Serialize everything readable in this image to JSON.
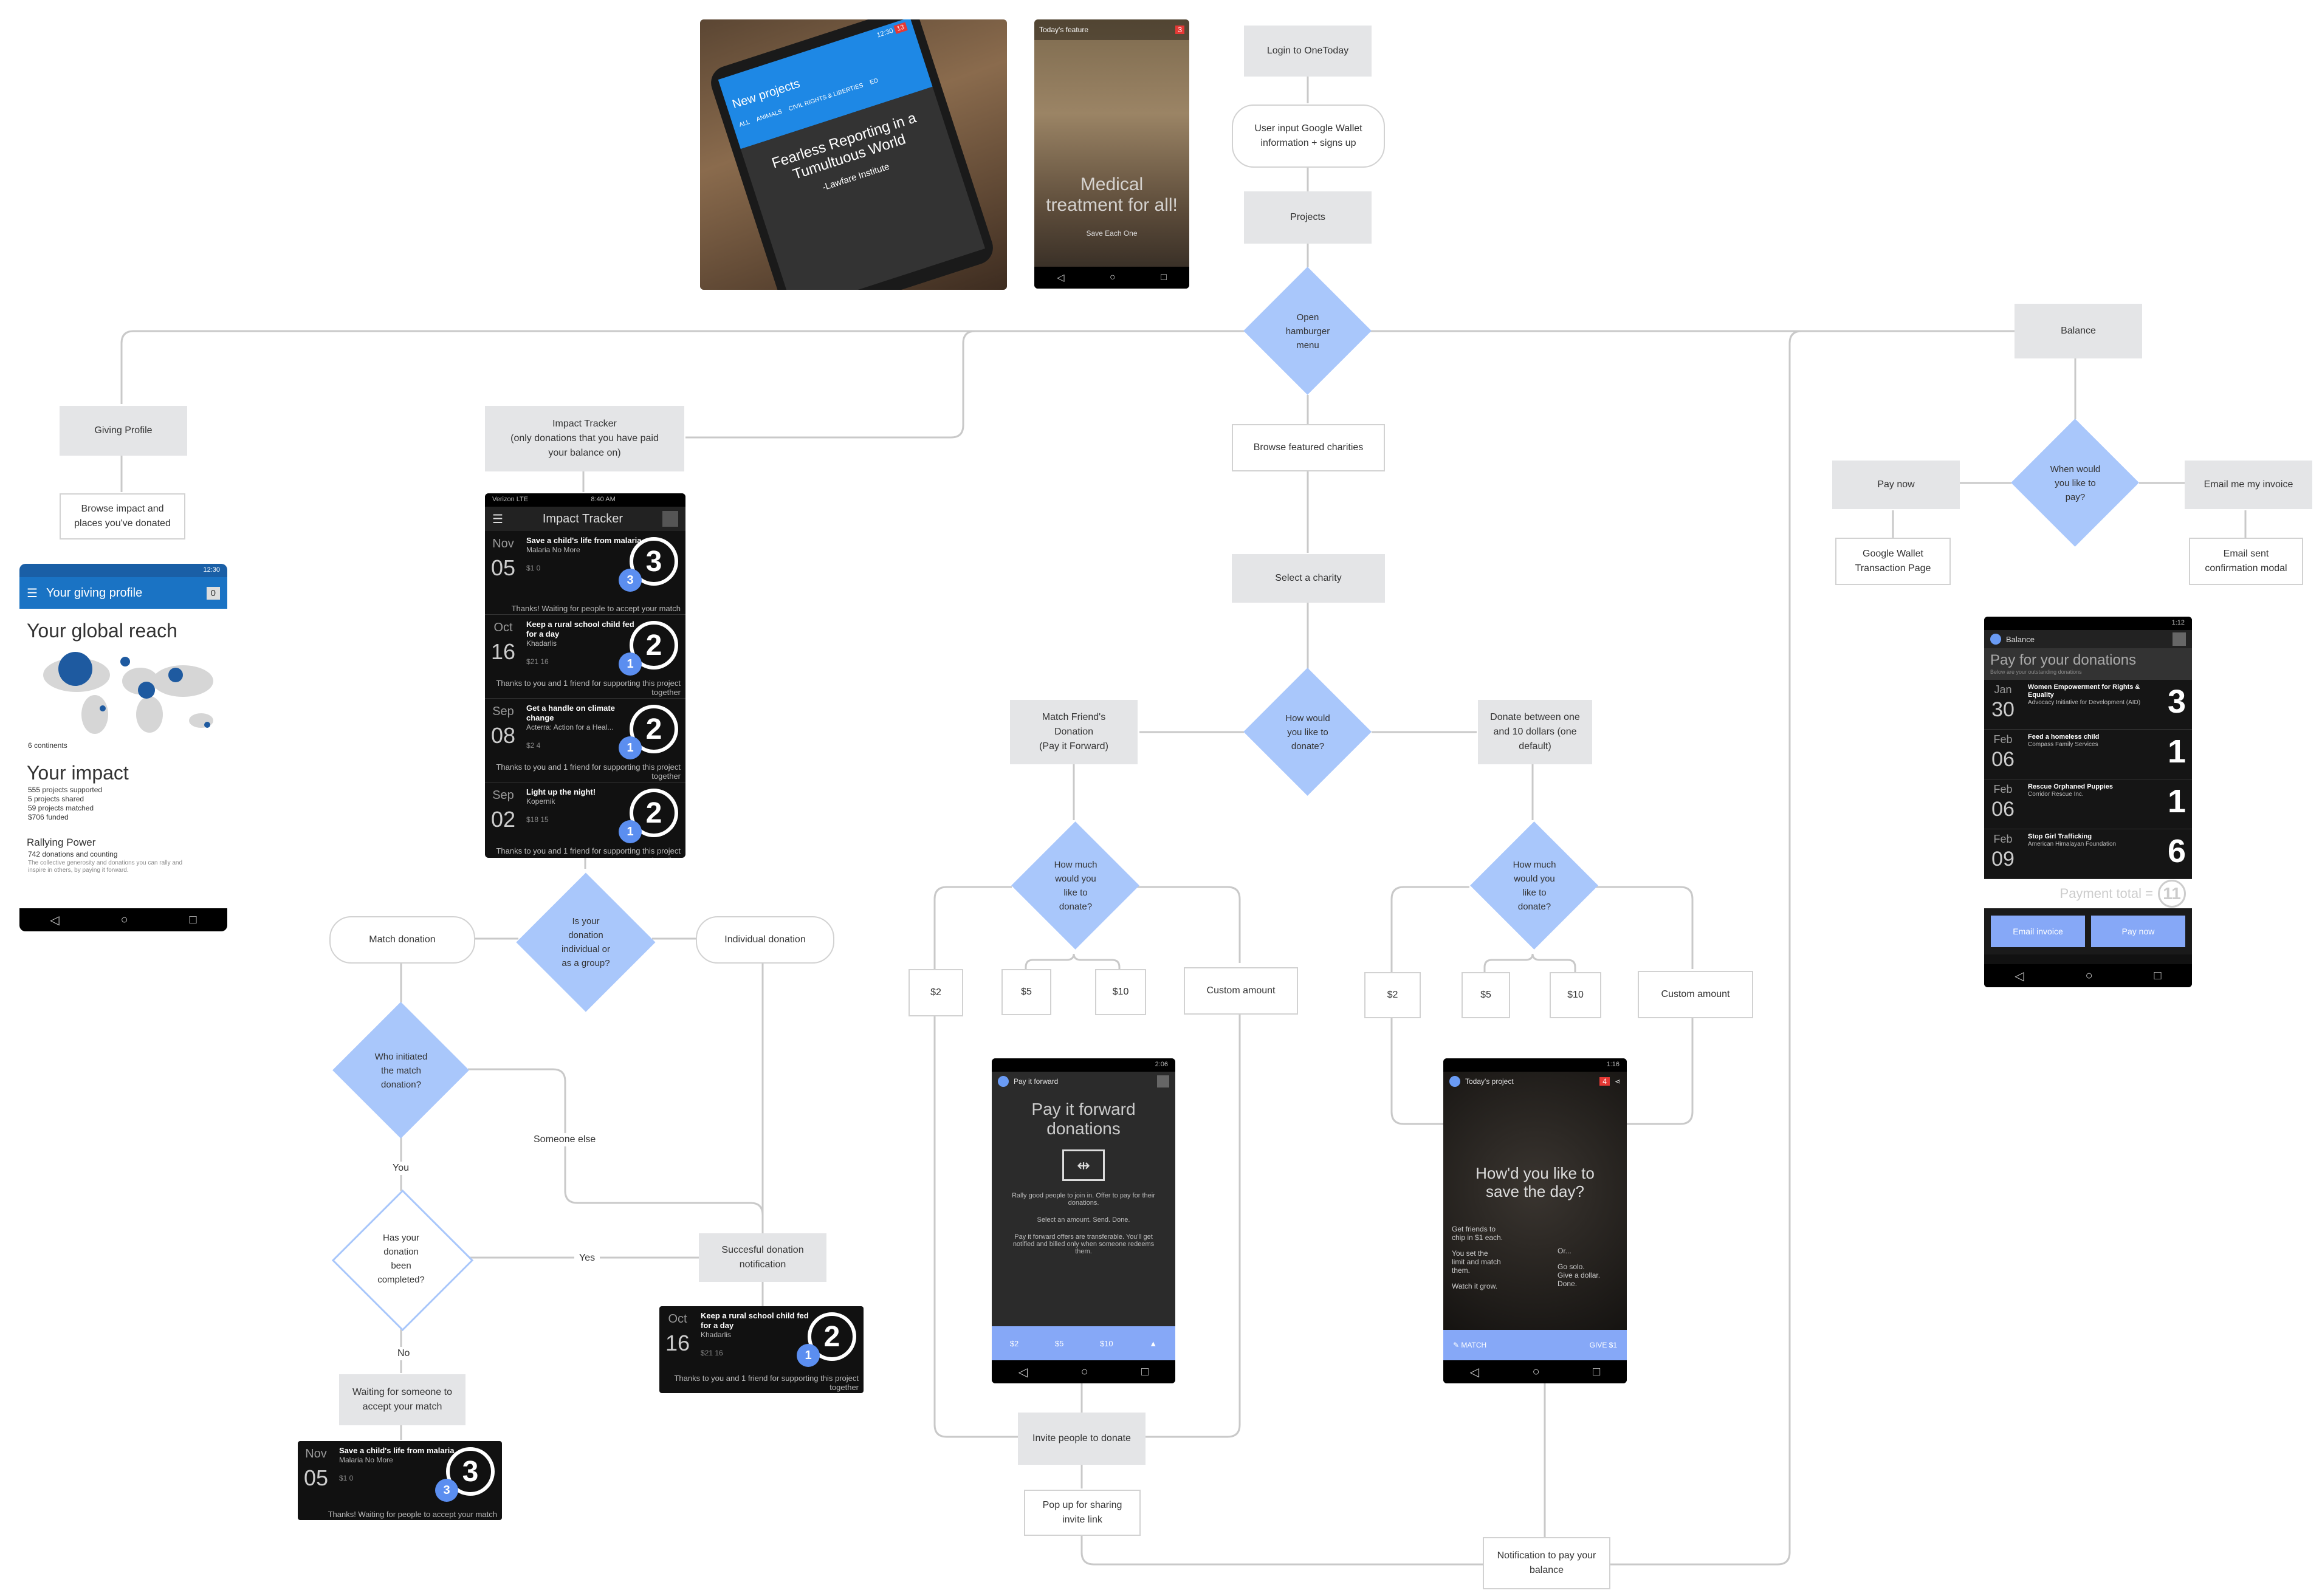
{
  "nodes": {
    "login": "Login to OneToday",
    "user_input": "User input Google Wallet\ninformation + signs up",
    "projects": "Projects",
    "open_menu": "Open\nhamburger\nmenu",
    "giving_profile": "Giving Profile",
    "browse_impact": "Browse impact and\nplaces you've donated",
    "impact_tracker": "Impact Tracker\n(only donations that you have paid\nyour balance on)",
    "browse_featured": "Browse featured charities",
    "select_charity": "Select a charity",
    "how_donate": "How would\nyou like to\ndonate?",
    "match_friend": "Match Friend's\nDonation\n(Pay it Forward)",
    "donate_between": "Donate between one\nand 10 dollars (one\ndefault)",
    "how_much": "How much\nwould you\nlike to\ndonate?",
    "amt_2": "$2",
    "amt_5": "$5",
    "amt_10": "$10",
    "custom_amount": "Custom amount",
    "individual_or_group": "Is your\ndonation\nindividual or\nas a group?",
    "match_donation": "Match donation",
    "individual_donation": "Individual donation",
    "who_initiated": "Who initiated\nthe match\ndonation?",
    "someone_else": "Someone else",
    "you": "You",
    "has_completed": "Has your\ndonation\nbeen\ncompleted?",
    "yes": "Yes",
    "no": "No",
    "success_notification": "Succesful donation\nnotification",
    "waiting": "Waiting for someone to\naccept your match",
    "invite": "Invite people to donate",
    "popup": "Pop up for sharing\ninvite link",
    "notification_pay": "Notification to pay your\nbalance",
    "balance": "Balance",
    "when_pay": "When would\nyou like to\npay?",
    "pay_now": "Pay now",
    "email_invoice": "Email me my invoice",
    "google_wallet": "Google Wallet\nTransaction Page",
    "email_sent": "Email sent\nconfirmation modal"
  },
  "photo1": {
    "time": "12:30",
    "badge": "13",
    "title": "New projects",
    "tabs": [
      "ALL",
      "ANIMALS",
      "CIVIL RIGHTS & LIBERTIES",
      "ED"
    ],
    "headline": "Fearless Reporting in a\nTumultuous World",
    "org": "-Lawfare Institute"
  },
  "photo2": {
    "title": "Today's feature",
    "badge": "3",
    "headline": "Medical\ntreatment for all!",
    "org": "Save Each One"
  },
  "profile": {
    "status": "12:30",
    "title": "Your giving profile",
    "badge": "0",
    "reach": "Your global reach",
    "continents": "6 continents",
    "impact": "Your impact",
    "stats": [
      "555 projects supported",
      "5 projects shared",
      "59 projects matched",
      "$706 funded"
    ],
    "rally": "Rallying Power",
    "rally_count": "742 donations and counting",
    "rally_note": "The collective generosity and donations you can rally and\ninspire in others, by paying it forward."
  },
  "tracker": {
    "status": "8:40 AM",
    "carrier": "Verizon LTE",
    "title": "Impact Tracker",
    "rows": [
      {
        "month": "Nov",
        "day": "05",
        "title": "Save a child's life from malaria",
        "org": "Malaria No More",
        "stats": "$1   0",
        "num": "3",
        "bubble": "3",
        "note": "Thanks! Waiting for people to accept your match"
      },
      {
        "month": "Oct",
        "day": "16",
        "title": "Keep a rural school child fed for a day",
        "org": "Khadarlis",
        "stats": "$21   16",
        "num": "2",
        "bubble": "1",
        "note": "Thanks to you and 1 friend for supporting this project together"
      },
      {
        "month": "Sep",
        "day": "08",
        "title": "Get a handle on climate change",
        "org": "Acterra: Action for a Heal...",
        "stats": "$2   4",
        "num": "2",
        "bubble": "1",
        "note": "Thanks to you and 1 friend for supporting this project together"
      },
      {
        "month": "Sep",
        "day": "02",
        "title": "Light up the night!",
        "org": "Kopernik",
        "stats": "$18   15",
        "num": "2",
        "bubble": "1",
        "note": "Thanks to you and 1 friend for supporting this project together"
      }
    ]
  },
  "card_oct": {
    "month": "Oct",
    "day": "16",
    "title": "Keep a rural school child fed for a day",
    "org": "Khadarlis",
    "stats": "$21   16",
    "num": "2",
    "bubble": "1",
    "note": "Thanks to you and 1 friend for supporting this project together"
  },
  "card_nov": {
    "month": "Nov",
    "day": "05",
    "title": "Save a child's life from malaria",
    "org": "Malaria No More",
    "stats": "$1   0",
    "num": "3",
    "bubble": "3",
    "note": "Thanks! Waiting for people to accept your match"
  },
  "pif": {
    "status": "2:06",
    "title": "Pay it forward",
    "heading": "Pay it forward\ndonations",
    "p1": "Rally good people to join in. Offer to pay for their donations.",
    "p2": "Select an amount. Send. Done.",
    "p3": "Pay it forward offers are transferable. You'll get notified and billed only when someone redeems them.",
    "amounts": [
      "$2",
      "$5",
      "$10"
    ]
  },
  "today": {
    "status": "1:16",
    "title": "Today's project",
    "badge": "4",
    "heading": "How'd you like to\nsave the day?",
    "left1": "Get friends to\nchip in $1 each.",
    "left2": "You set the\nlimit and match\nthem.",
    "left3": "Watch it grow.",
    "right1": "Or...",
    "right2": "Go solo.\nGive a dollar.\nDone.",
    "match": "MATCH",
    "give": "GIVE $1"
  },
  "balance_phone": {
    "status": "1:12",
    "title": "Balance",
    "heading": "Pay for your donations",
    "sub": "Below are your outstanding donations",
    "rows": [
      {
        "month": "Jan",
        "day": "30",
        "title": "Women Empowerment for Rights & Equality",
        "org": "Advocacy Initiative for Development (AID)",
        "num": "3"
      },
      {
        "month": "Feb",
        "day": "06",
        "title": "Feed a homeless child",
        "org": "Compass Family Services",
        "num": "1"
      },
      {
        "month": "Feb",
        "day": "06",
        "title": "Rescue Orphaned Puppies",
        "org": "Corridor Rescue Inc.",
        "num": "1"
      },
      {
        "month": "Feb",
        "day": "09",
        "title": "Stop Girl Trafficking",
        "org": "American Himalayan Foundation",
        "num": "6"
      }
    ],
    "total_label": "Payment total =",
    "total": "11",
    "email_btn": "Email invoice",
    "pay_btn": "Pay now"
  },
  "colors": {
    "diamond": "#a9c7fb",
    "box": "#e4e5e7",
    "accent": "#1a73c4",
    "phone_btn": "#86a8f7"
  }
}
